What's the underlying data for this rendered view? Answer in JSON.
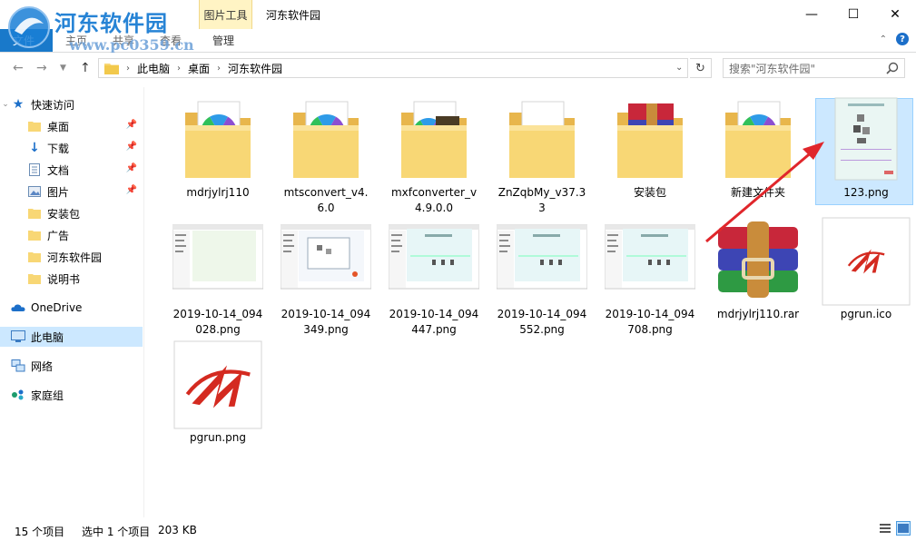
{
  "window": {
    "title": "河东软件园",
    "tool_group": "图片工具",
    "manage_tab": "管理",
    "file_tab": "文件",
    "home_tab": "主页",
    "share_tab": "共享",
    "view_tab": "查看",
    "minimize_glyph": "—",
    "maximize_glyph": "☐",
    "close_glyph": "✕"
  },
  "watermark": {
    "title": "河东软件园",
    "url": "www.pc0359.cn"
  },
  "address": {
    "crumbs": [
      "此电脑",
      "桌面",
      "河东软件园"
    ]
  },
  "search": {
    "placeholder": "搜索\"河东软件园\""
  },
  "sidebar": {
    "quick_access": "快速访问",
    "items": [
      {
        "label": "桌面",
        "pinned": true
      },
      {
        "label": "下载",
        "pinned": true
      },
      {
        "label": "文档",
        "pinned": true
      },
      {
        "label": "图片",
        "pinned": true
      },
      {
        "label": "安装包",
        "pinned": false
      },
      {
        "label": "广告",
        "pinned": false
      },
      {
        "label": "河东软件园",
        "pinned": false
      },
      {
        "label": "说明书",
        "pinned": false
      }
    ],
    "onedrive": "OneDrive",
    "this_pc": "此电脑",
    "network": "网络",
    "homegroup": "家庭组"
  },
  "files": [
    {
      "name": "mdrjylrj110",
      "kind": "folder-app"
    },
    {
      "name": "mtsconvert_v4.6.0",
      "kind": "folder-app"
    },
    {
      "name": "mxfconverter_v4.9.0.0",
      "kind": "folder-film"
    },
    {
      "name": "ZnZqbMy_v37.33",
      "kind": "folder-doc"
    },
    {
      "name": "安装包",
      "kind": "folder-rar"
    },
    {
      "name": "新建文件夹",
      "kind": "folder-app"
    },
    {
      "name": "123.png",
      "kind": "image-doc",
      "selected": true
    },
    {
      "name": "2019-10-14_094028.png",
      "kind": "screenshot-blank"
    },
    {
      "name": "2019-10-14_094349.png",
      "kind": "screenshot-dialog"
    },
    {
      "name": "2019-10-14_094447.png",
      "kind": "screenshot-sheet"
    },
    {
      "name": "2019-10-14_094552.png",
      "kind": "screenshot-sheet"
    },
    {
      "name": "2019-10-14_094708.png",
      "kind": "screenshot-sheet"
    },
    {
      "name": "mdrjylrj110.rar",
      "kind": "rar"
    },
    {
      "name": "pgrun.ico",
      "kind": "ico"
    },
    {
      "name": "pgrun.png",
      "kind": "png-logo"
    }
  ],
  "status": {
    "count": "15 个项目",
    "selection": "选中 1 个项目",
    "size": "203 KB"
  },
  "colors": {
    "accent": "#1979ca",
    "selection": "#cce8ff",
    "folder": "#f8d775",
    "arrow": "#e0262b"
  }
}
